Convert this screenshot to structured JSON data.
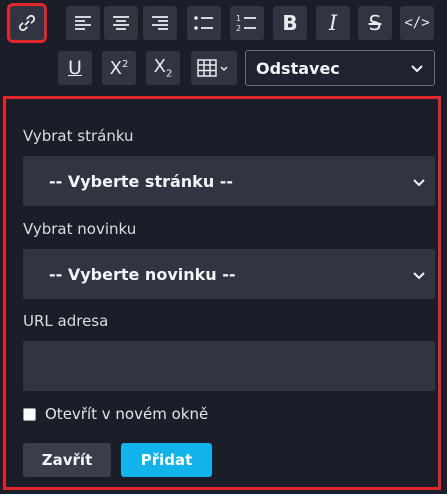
{
  "toolbar": {
    "buttons": [
      {
        "id": "link",
        "icon": "link-icon",
        "active": true
      },
      {
        "id": "align-left",
        "icon": "align-left-icon"
      },
      {
        "id": "align-center",
        "icon": "align-center-icon"
      },
      {
        "id": "align-right",
        "icon": "align-right-icon"
      },
      {
        "id": "bullet-list",
        "icon": "bullet-list-icon"
      },
      {
        "id": "numbered-list",
        "icon": "numbered-list-icon"
      },
      {
        "id": "bold",
        "icon": "bold-icon",
        "glyph": "B"
      },
      {
        "id": "italic",
        "icon": "italic-icon",
        "glyph": "I"
      },
      {
        "id": "strikethrough",
        "icon": "strikethrough-icon",
        "glyph": "S"
      },
      {
        "id": "code",
        "icon": "code-icon",
        "glyph": "</>"
      },
      {
        "id": "underline",
        "icon": "underline-icon",
        "glyph": "U"
      },
      {
        "id": "superscript",
        "icon": "superscript-icon",
        "glyph": "X",
        "small": "2"
      },
      {
        "id": "subscript",
        "icon": "subscript-icon",
        "glyph": "X",
        "small": "2"
      },
      {
        "id": "table",
        "icon": "table-icon"
      }
    ],
    "format_select": {
      "value": "Odstavec",
      "icon": "chevron-down-icon"
    }
  },
  "dialog": {
    "page_label": "Vybrat stránku",
    "page_select_value": "-- Vyberte stránku --",
    "news_label": "Vybrat novinku",
    "news_select_value": "-- Vyberte novinku --",
    "url_label": "URL adresa",
    "url_value": "",
    "new_window_label": "Otevřít v novém okně",
    "new_window_checked": false,
    "close_button": "Zavřít",
    "add_button": "Přidat"
  },
  "colors": {
    "background": "#1b1e28",
    "button_bg": "#313542",
    "highlight": "#e3262d",
    "primary": "#12b2ea"
  }
}
